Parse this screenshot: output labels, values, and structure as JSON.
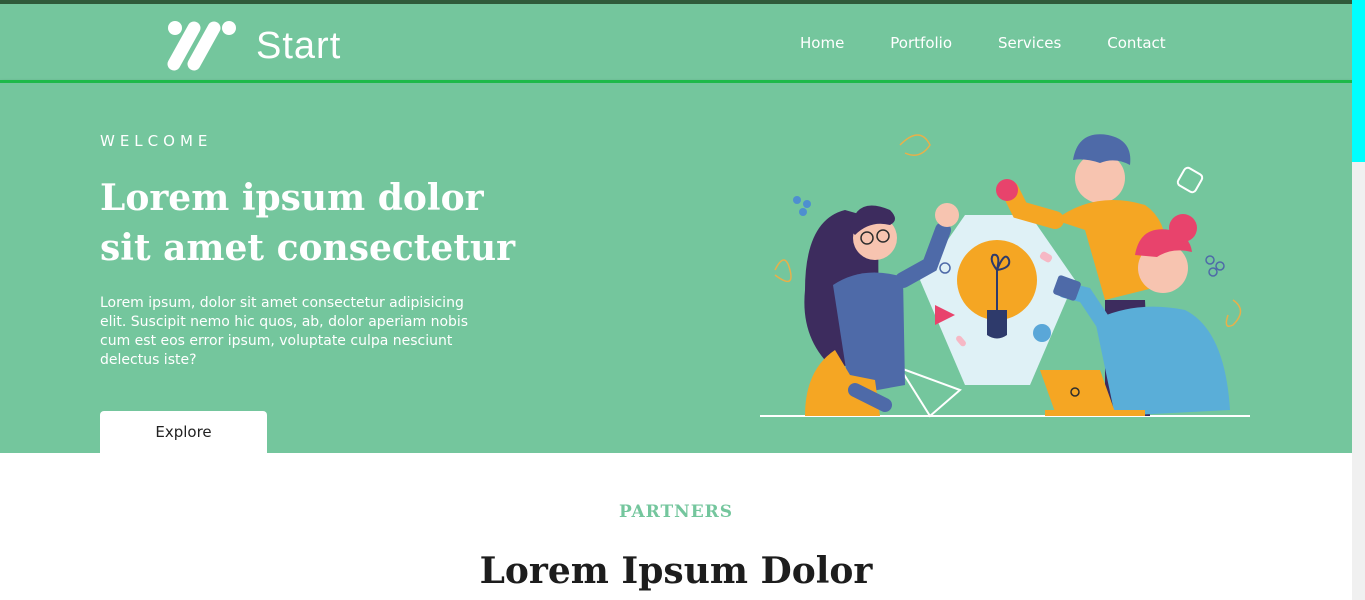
{
  "brand": {
    "name": "Start"
  },
  "nav": {
    "items": [
      "Home",
      "Portfolio",
      "Services",
      "Contact"
    ]
  },
  "hero": {
    "eyebrow": "WELCOME",
    "headline": "Lorem ipsum dolor sit amet consectetur",
    "body": "Lorem ipsum, dolor sit amet consectetur adipisicing elit. Suscipit nemo hic quos, ab, dolor aperiam nobis cum est eos error ipsum, voluptate culpa nesciunt delectus iste?",
    "cta_label": "Explore"
  },
  "partners": {
    "label": "PARTNERS",
    "title": "Lorem Ipsum Dolor"
  },
  "colors": {
    "primary": "#74c69d",
    "accent_line": "#1db94a",
    "text_light": "#ffffff",
    "text_dark": "#1d1d1d",
    "scroll_thumb": "#00ffff"
  },
  "icons": {
    "logo": "slash-marks-logo-icon",
    "illustration": "team-lightbulb-illustration"
  }
}
